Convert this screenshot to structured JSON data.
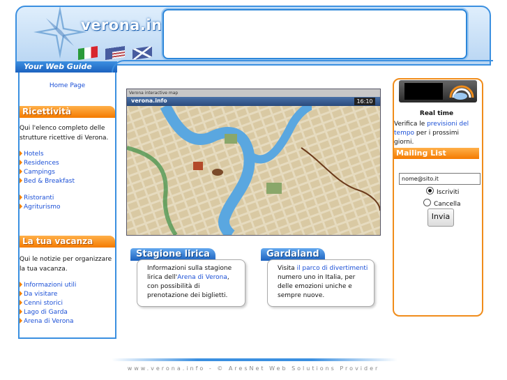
{
  "header": {
    "logo": "verona.info",
    "web_guide": "Your Web Guide",
    "flags": [
      "italian-flag",
      "us-flag",
      "uk-flag"
    ]
  },
  "sidebar": {
    "home": "Home Page",
    "ricettivita": {
      "title": "Ricettività",
      "text": "Qui l'elenco completo delle strutture ricettive di Verona.",
      "links": [
        "Hotels",
        "Residences",
        "Campings",
        "Bed & Breakfast"
      ],
      "links2": [
        "Ristoranti",
        "Agriturismo"
      ]
    },
    "vacanza": {
      "title": "La tua vacanza",
      "text": "Qui le notizie per organizzare la tua vacanza.",
      "links": [
        "Informazioni utili",
        "Da visitare",
        "Cenni storici",
        "Lago di Garda",
        "Arena di Verona"
      ]
    }
  },
  "map": {
    "title": "Verona interactive map",
    "brand": "verona.info",
    "time": "16:10"
  },
  "boxes": {
    "lirica": {
      "tab": "Stagione lirica",
      "text_before": "Informazioni sulla stagione lirica dell'",
      "link": "Arena di Verona",
      "text_after": ", con possibilità di prenotazione dei biglietti."
    },
    "gardaland": {
      "tab": "Gardaland",
      "text_before": "Visita ",
      "link": "il parco di divertimenti",
      "text_after": " numero uno in Italia, per delle emozioni uniche e sempre nuove."
    }
  },
  "right": {
    "realtime_title": "Real time",
    "realtime_before": "Verifica le ",
    "realtime_link": "previsioni del tempo",
    "realtime_after": " per i prossimi giorni.",
    "mailing_title": "Mailing List",
    "email_value": "nome@sito.it",
    "opt_subscribe": "Iscriviti",
    "opt_cancel": "Cancella",
    "submit": "Invia"
  },
  "footer": "www.verona.info - © AresNet Web Solutions Provider",
  "colors": {
    "blue": "#3a8fe0",
    "orange": "#f08c1a",
    "link": "#1a4fd6"
  }
}
